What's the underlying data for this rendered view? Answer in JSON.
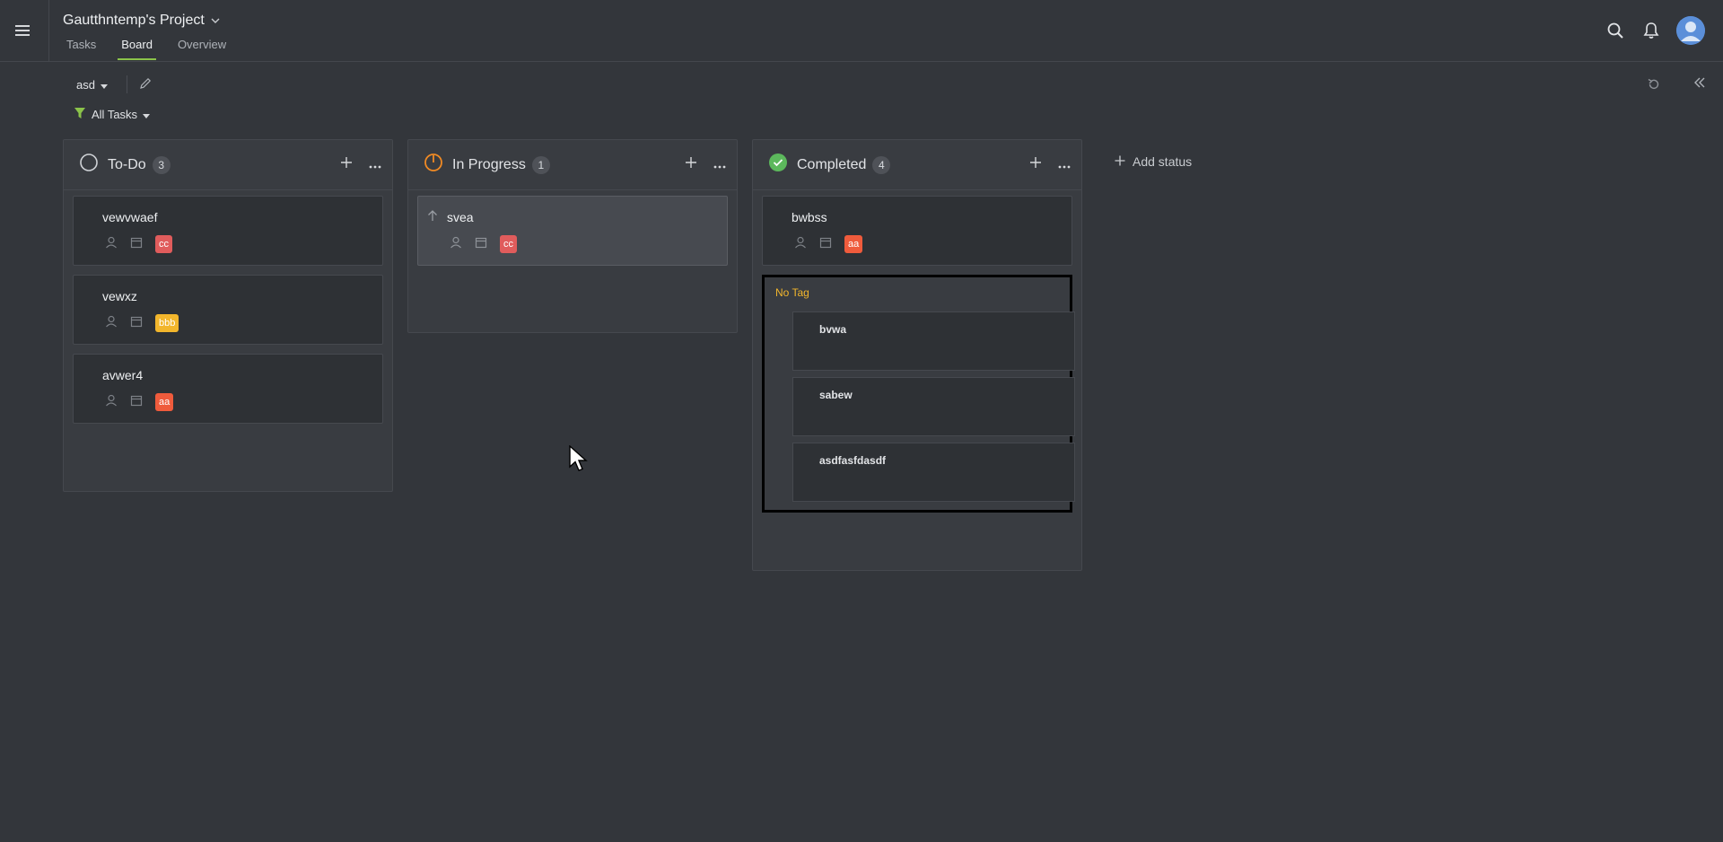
{
  "header": {
    "project_title": "Gautthntemp's Project",
    "tabs": [
      {
        "label": "Tasks",
        "active": false
      },
      {
        "label": "Board",
        "active": true
      },
      {
        "label": "Overview",
        "active": false
      }
    ]
  },
  "toolbar": {
    "view_name": "asd",
    "filter_label": "All Tasks"
  },
  "columns": [
    {
      "title": "To-Do",
      "count": "3",
      "status_color": "#cfd2d6",
      "cards": [
        {
          "title": "vewvwaef",
          "tag": "cc",
          "tag_color": "#e05c5c"
        },
        {
          "title": "vewxz",
          "tag": "bbb",
          "tag_color": "#f2b62c"
        },
        {
          "title": "avwer4",
          "tag": "aa",
          "tag_color": "#ef5b3c"
        }
      ]
    },
    {
      "title": "In Progress",
      "count": "1",
      "status_color": "#f08a24",
      "cards": [
        {
          "title": "svea",
          "tag": "cc",
          "tag_color": "#e05c5c"
        }
      ]
    },
    {
      "title": "Completed",
      "count": "4",
      "status_color": "#5cb85c",
      "cards": [
        {
          "title": "bwbss",
          "tag": "aa",
          "tag_color": "#ef5b3c"
        }
      ],
      "group": {
        "label": "No Tag",
        "items": [
          "bvwa",
          "sabew",
          "asdfasfdasdf"
        ]
      }
    }
  ],
  "add_status_label": "Add status",
  "colors": {
    "accent": "#8bc34a",
    "background": "#33363b",
    "column_bg": "#393c41",
    "card_bg": "#2e3135"
  }
}
